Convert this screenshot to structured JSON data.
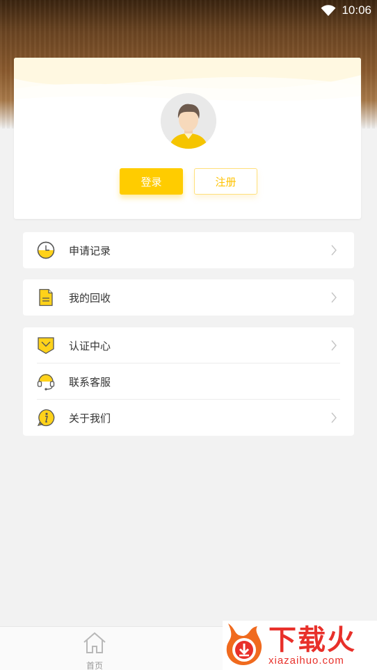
{
  "status_bar": {
    "time": "10:06",
    "wifi_icon": "wifi-icon"
  },
  "profile": {
    "avatar_icon": "user-avatar-icon",
    "login_label": "登录",
    "register_label": "注册"
  },
  "menu_groups": [
    [
      {
        "label": "申请记录",
        "icon": "clock-icon",
        "chevron": true
      }
    ],
    [
      {
        "label": "我的回收",
        "icon": "document-icon",
        "chevron": true
      }
    ],
    [
      {
        "label": "认证中心",
        "icon": "certificate-icon",
        "chevron": true
      },
      {
        "label": "联系客服",
        "icon": "headset-icon",
        "chevron": false
      },
      {
        "label": "关于我们",
        "icon": "info-icon",
        "chevron": true
      }
    ]
  ],
  "bottom_nav": {
    "home_label": "首页",
    "home_icon": "home-icon"
  },
  "watermark": {
    "title": "下载火",
    "subtitle": "xiazaihuo.com"
  },
  "colors": {
    "accent": "#ffcc00",
    "header_brown": "#6b4522",
    "watermark_red": "#e8302a"
  }
}
